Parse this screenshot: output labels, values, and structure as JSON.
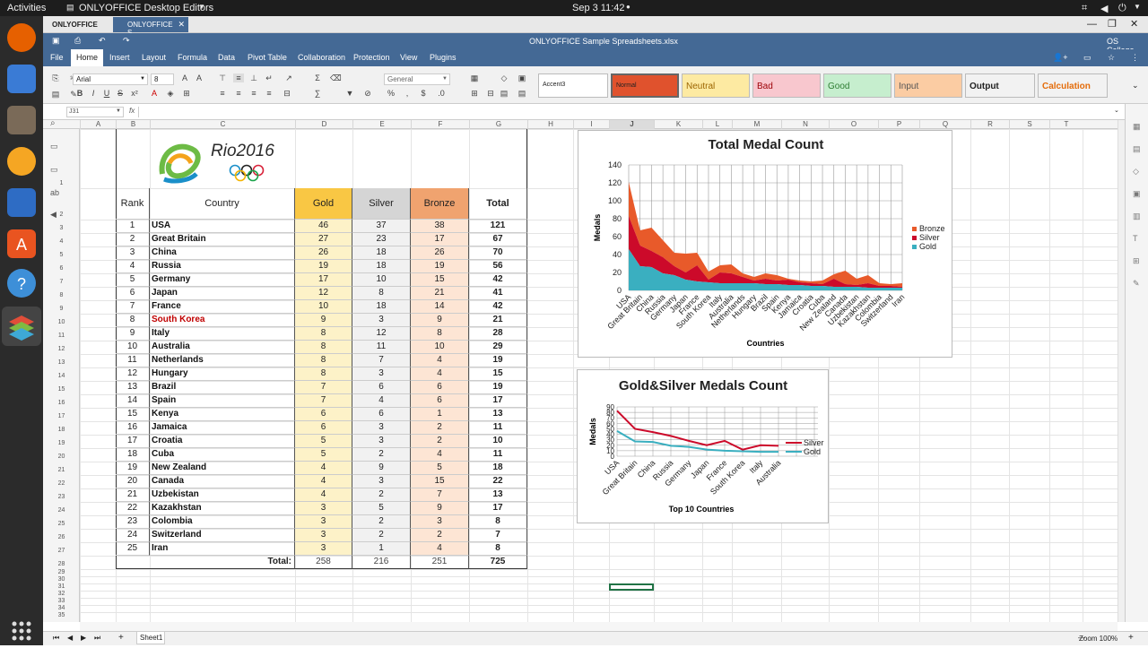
{
  "topbar": {
    "activities": "Activities",
    "app": "ONLYOFFICE Desktop Editors",
    "clock": "Sep 3  11:42"
  },
  "tabs": {
    "home": "ONLYOFFICE",
    "doc": "ONLYOFFICE S..."
  },
  "titlebar": {
    "doc_title": "ONLYOFFICE Sample Spreadsheets.xlsx",
    "user": "OS College"
  },
  "menu": [
    "File",
    "Home",
    "Insert",
    "Layout",
    "Formula",
    "Data",
    "Pivot Table",
    "Collaboration",
    "Protection",
    "View",
    "Plugins"
  ],
  "toolbar": {
    "font": "Arial",
    "size": "8",
    "numfmt": "General"
  },
  "styles": [
    {
      "label": "Accent3",
      "bg": "#ffffff",
      "fg": "#222222"
    },
    {
      "label": "Normal",
      "bg": "#e0522d",
      "fg": "#222222"
    },
    {
      "label": "Neutral",
      "bg": "#fdeaa2",
      "fg": "#9c6500"
    },
    {
      "label": "Bad",
      "bg": "#f8c7ce",
      "fg": "#9c0006"
    },
    {
      "label": "Good",
      "bg": "#c6eece",
      "fg": "#2e7d32"
    },
    {
      "label": "Input",
      "bg": "#fbcca3",
      "fg": "#555555"
    },
    {
      "label": "Output",
      "bg": "#f2f2f2",
      "fg": "#222222"
    },
    {
      "label": "Calculation",
      "bg": "#f2f2f2",
      "fg": "#e46c0a"
    }
  ],
  "formula": {
    "cellref": "J31",
    "fx": "fx",
    "value": ""
  },
  "columns": [
    "A",
    "B",
    "C",
    "D",
    "E",
    "F",
    "G",
    "H",
    "I",
    "J",
    "K",
    "L",
    "M",
    "N",
    "O",
    "P",
    "Q",
    "R",
    "S",
    "T"
  ],
  "rows": [
    "1",
    "2",
    "3",
    "4",
    "5",
    "6",
    "7",
    "8",
    "9",
    "10",
    "11",
    "12",
    "13",
    "14",
    "15",
    "16",
    "17",
    "18",
    "19",
    "20",
    "21",
    "22",
    "23",
    "24",
    "25",
    "26",
    "27",
    "28",
    "29",
    "30",
    "31",
    "32",
    "33",
    "34",
    "35"
  ],
  "logo": {
    "text": "Rio2016"
  },
  "table": {
    "headers": {
      "rank": "Rank",
      "country": "Country",
      "gold": "Gold",
      "silver": "Silver",
      "bronze": "Bronze",
      "total": "Total"
    },
    "rows": [
      {
        "rank": "1",
        "country": "USA",
        "gold": "46",
        "silver": "37",
        "bronze": "38",
        "total": "121"
      },
      {
        "rank": "2",
        "country": "Great Britain",
        "gold": "27",
        "silver": "23",
        "bronze": "17",
        "total": "67"
      },
      {
        "rank": "3",
        "country": "China",
        "gold": "26",
        "silver": "18",
        "bronze": "26",
        "total": "70"
      },
      {
        "rank": "4",
        "country": "Russia",
        "gold": "19",
        "silver": "18",
        "bronze": "19",
        "total": "56"
      },
      {
        "rank": "5",
        "country": "Germany",
        "gold": "17",
        "silver": "10",
        "bronze": "15",
        "total": "42"
      },
      {
        "rank": "6",
        "country": "Japan",
        "gold": "12",
        "silver": "8",
        "bronze": "21",
        "total": "41"
      },
      {
        "rank": "7",
        "country": "France",
        "gold": "10",
        "silver": "18",
        "bronze": "14",
        "total": "42"
      },
      {
        "rank": "8",
        "country": "South Korea",
        "gold": "9",
        "silver": "3",
        "bronze": "9",
        "total": "21"
      },
      {
        "rank": "9",
        "country": "Italy",
        "gold": "8",
        "silver": "12",
        "bronze": "8",
        "total": "28"
      },
      {
        "rank": "10",
        "country": "Australia",
        "gold": "8",
        "silver": "11",
        "bronze": "10",
        "total": "29"
      },
      {
        "rank": "11",
        "country": "Netherlands",
        "gold": "8",
        "silver": "7",
        "bronze": "4",
        "total": "19"
      },
      {
        "rank": "12",
        "country": "Hungary",
        "gold": "8",
        "silver": "3",
        "bronze": "4",
        "total": "15"
      },
      {
        "rank": "13",
        "country": "Brazil",
        "gold": "7",
        "silver": "6",
        "bronze": "6",
        "total": "19"
      },
      {
        "rank": "14",
        "country": "Spain",
        "gold": "7",
        "silver": "4",
        "bronze": "6",
        "total": "17"
      },
      {
        "rank": "15",
        "country": "Kenya",
        "gold": "6",
        "silver": "6",
        "bronze": "1",
        "total": "13"
      },
      {
        "rank": "16",
        "country": "Jamaica",
        "gold": "6",
        "silver": "3",
        "bronze": "2",
        "total": "11"
      },
      {
        "rank": "17",
        "country": "Croatia",
        "gold": "5",
        "silver": "3",
        "bronze": "2",
        "total": "10"
      },
      {
        "rank": "18",
        "country": "Cuba",
        "gold": "5",
        "silver": "2",
        "bronze": "4",
        "total": "11"
      },
      {
        "rank": "19",
        "country": "New Zealand",
        "gold": "4",
        "silver": "9",
        "bronze": "5",
        "total": "18"
      },
      {
        "rank": "20",
        "country": "Canada",
        "gold": "4",
        "silver": "3",
        "bronze": "15",
        "total": "22"
      },
      {
        "rank": "21",
        "country": "Uzbekistan",
        "gold": "4",
        "silver": "2",
        "bronze": "7",
        "total": "13"
      },
      {
        "rank": "22",
        "country": "Kazakhstan",
        "gold": "3",
        "silver": "5",
        "bronze": "9",
        "total": "17"
      },
      {
        "rank": "23",
        "country": "Colombia",
        "gold": "3",
        "silver": "2",
        "bronze": "3",
        "total": "8"
      },
      {
        "rank": "24",
        "country": "Switzerland",
        "gold": "3",
        "silver": "2",
        "bronze": "2",
        "total": "7"
      },
      {
        "rank": "25",
        "country": "Iran",
        "gold": "3",
        "silver": "1",
        "bronze": "4",
        "total": "8"
      }
    ],
    "total_label": "Total:",
    "totals": {
      "gold": "258",
      "silver": "216",
      "bronze": "251",
      "total": "725"
    }
  },
  "status": {
    "sheet": "Sheet1",
    "zoom": "Zoom 100%"
  },
  "colors": {
    "gold": "#f9c744",
    "silver": "#d5d5d5",
    "bronze": "#f0a36f",
    "chart_gold": "#3aafc0",
    "chart_silver": "#cc0a2a",
    "chart_bronze": "#e85a2a"
  },
  "chart_data": [
    {
      "type": "area",
      "title": "Total Medal Count",
      "xlabel": "Countries",
      "ylabel": "Medals",
      "ylim": [
        0,
        140
      ],
      "yticks": [
        "0",
        "20",
        "40",
        "60",
        "80",
        "100",
        "120",
        "140"
      ],
      "stacked": true,
      "legend": "right",
      "grid": true,
      "categories": [
        "USA",
        "Great Britain",
        "China",
        "Russia",
        "Germany",
        "Japan",
        "France",
        "South Korea",
        "Italy",
        "Australia",
        "Netherlands",
        "Hungary",
        "Brazil",
        "Spain",
        "Kenya",
        "Jamaica",
        "Croatia",
        "Cuba",
        "New Zealand",
        "Canada",
        "Uzbekistan",
        "Kazakhstan",
        "Colombia",
        "Switzerland",
        "Iran"
      ],
      "series": [
        {
          "name": "Gold",
          "values": [
            46,
            27,
            26,
            19,
            17,
            12,
            10,
            9,
            8,
            8,
            8,
            8,
            7,
            7,
            6,
            6,
            5,
            5,
            4,
            4,
            4,
            3,
            3,
            3,
            3
          ]
        },
        {
          "name": "Silver",
          "values": [
            37,
            23,
            18,
            18,
            10,
            8,
            18,
            3,
            12,
            11,
            7,
            3,
            6,
            4,
            6,
            3,
            3,
            2,
            9,
            3,
            2,
            5,
            2,
            2,
            1
          ]
        },
        {
          "name": "Bronze",
          "values": [
            38,
            17,
            26,
            19,
            15,
            21,
            14,
            9,
            8,
            10,
            4,
            4,
            6,
            6,
            1,
            2,
            2,
            4,
            5,
            15,
            7,
            9,
            3,
            2,
            4
          ]
        }
      ],
      "legend_order": [
        "Bronze",
        "Silver",
        "Gold"
      ]
    },
    {
      "type": "line",
      "title": "Gold&Silver Medals Count",
      "xlabel": "Top 10 Countries",
      "ylabel": "Medals",
      "ylim": [
        0,
        90
      ],
      "yticks": [
        "0",
        "10",
        "20",
        "30",
        "40",
        "50",
        "60",
        "70",
        "80",
        "90"
      ],
      "legend": "right",
      "grid": true,
      "categories": [
        "USA",
        "Great Britain",
        "China",
        "Russia",
        "Germany",
        "Japan",
        "France",
        "South Korea",
        "Italy",
        "Australia"
      ],
      "series": [
        {
          "name": "Silver",
          "values": [
            83,
            50,
            44,
            37,
            28,
            20,
            28,
            12,
            20,
            19
          ]
        },
        {
          "name": "Gold",
          "values": [
            46,
            27,
            26,
            19,
            17,
            12,
            10,
            9,
            8,
            8
          ]
        }
      ],
      "legend_order": [
        "Silver",
        "Gold"
      ]
    }
  ]
}
